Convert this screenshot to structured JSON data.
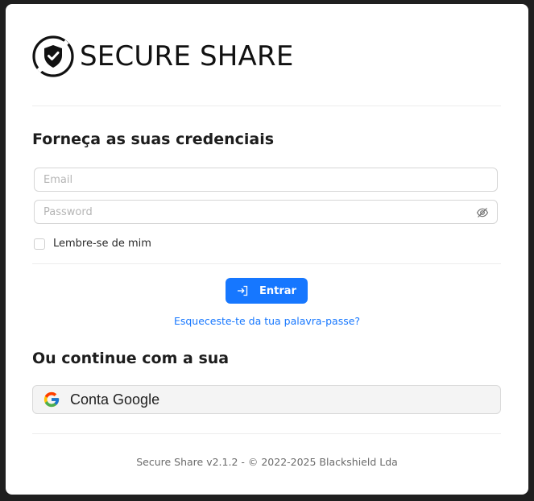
{
  "brand": {
    "name": "SECURE SHARE",
    "logo_icon": "shield-check-icon"
  },
  "login": {
    "heading": "Forneça as suas credenciais",
    "email_placeholder": "Email",
    "password_placeholder": "Password",
    "password_toggle_icon": "eye-off-icon",
    "remember_label": "Lembre-se de mim",
    "submit_label": "Entrar",
    "submit_icon": "sign-in-icon",
    "forgot_label": "Esqueceste-te da tua palavra-passe?"
  },
  "alternative": {
    "heading": "Ou continue com a sua",
    "google_label": "Conta Google",
    "google_icon": "google-icon"
  },
  "footer": {
    "text": "Secure Share v2.1.2 - © 2022-2025 Blackshield Lda"
  },
  "colors": {
    "primary": "#1677ff",
    "background": "#1f1f1f",
    "card": "#ffffff"
  }
}
